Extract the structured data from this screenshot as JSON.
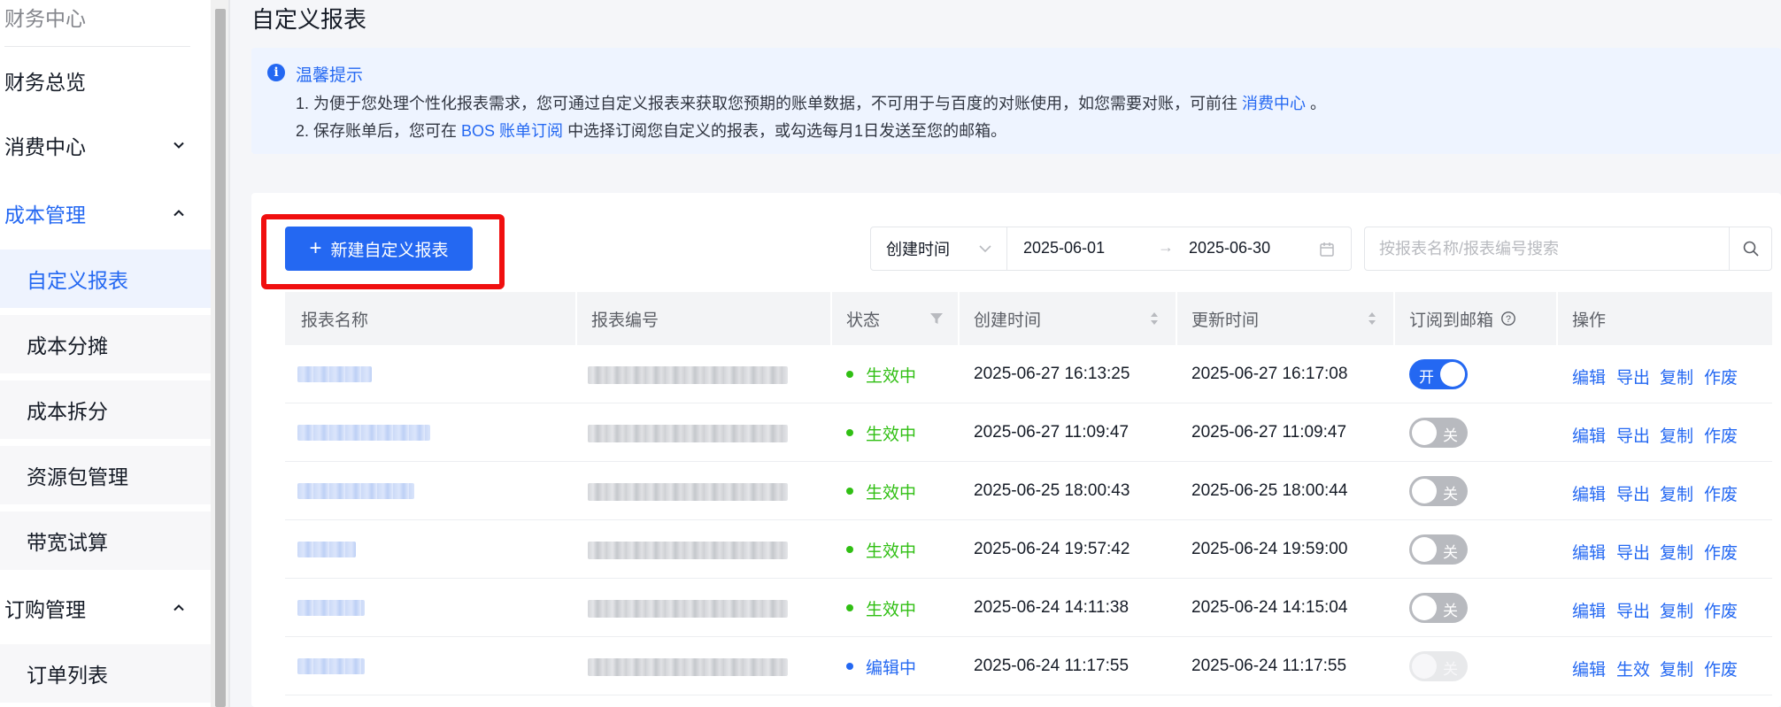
{
  "sidebar": {
    "title": "财务中心",
    "items": [
      {
        "label": "财务总览"
      },
      {
        "label": "消费中心"
      },
      {
        "label": "成本管理"
      },
      {
        "label": "自定义报表"
      },
      {
        "label": "成本分摊"
      },
      {
        "label": "成本拆分"
      },
      {
        "label": "资源包管理"
      },
      {
        "label": "带宽试算"
      },
      {
        "label": "订购管理"
      },
      {
        "label": "订单列表"
      }
    ]
  },
  "page": {
    "title": "自定义报表"
  },
  "notice": {
    "title": "温馨提示",
    "line1_pre": "1.  为便于您处理个性化报表需求，您可通过自定义报表来获取您预期的账单数据，不可用于与百度的对账使用，如您需要对账，可前往",
    "line1_link": "消费中心",
    "line1_post": "。",
    "line2_pre": "2.  保存账单后，您可在",
    "line2_link": "BOS 账单订阅",
    "line2_post": "中选择订阅您自定义的报表，或勾选每月1日发送至您的邮箱。"
  },
  "toolbar": {
    "new_button": "新建自定义报表",
    "date_type": "创建时间",
    "date_start": "2025-06-01",
    "date_arrow": "→",
    "date_end": "2025-06-30",
    "search_placeholder": "按报表名称/报表编号搜索"
  },
  "table": {
    "columns": [
      "报表名称",
      "报表编号",
      "状态",
      "创建时间",
      "更新时间",
      "订阅到邮箱",
      "操作"
    ],
    "rows": [
      {
        "status": "生效中",
        "created": "2025-06-27 16:13:25",
        "updated": "2025-06-27 16:17:08",
        "subscribe": "开",
        "ops": [
          "编辑",
          "导出",
          "复制",
          "作废"
        ]
      },
      {
        "status": "生效中",
        "created": "2025-06-27 11:09:47",
        "updated": "2025-06-27 11:09:47",
        "subscribe": "关",
        "ops": [
          "编辑",
          "导出",
          "复制",
          "作废"
        ]
      },
      {
        "status": "生效中",
        "created": "2025-06-25 18:00:43",
        "updated": "2025-06-25 18:00:44",
        "subscribe": "关",
        "ops": [
          "编辑",
          "导出",
          "复制",
          "作废"
        ]
      },
      {
        "status": "生效中",
        "created": "2025-06-24 19:57:42",
        "updated": "2025-06-24 19:59:00",
        "subscribe": "关",
        "ops": [
          "编辑",
          "导出",
          "复制",
          "作废"
        ]
      },
      {
        "status": "生效中",
        "created": "2025-06-24 14:11:38",
        "updated": "2025-06-24 14:15:04",
        "subscribe": "关",
        "ops": [
          "编辑",
          "导出",
          "复制",
          "作废"
        ]
      },
      {
        "status": "编辑中",
        "created": "2025-06-24 11:17:55",
        "updated": "2025-06-24 11:17:55",
        "subscribe": "关",
        "ops": [
          "编辑",
          "生效",
          "复制",
          "作废"
        ]
      }
    ]
  },
  "colors": {
    "accent": "#2468f2",
    "status_active": "#30bf13",
    "status_editing": "#2468f2",
    "highlight": "#f00f0f"
  }
}
